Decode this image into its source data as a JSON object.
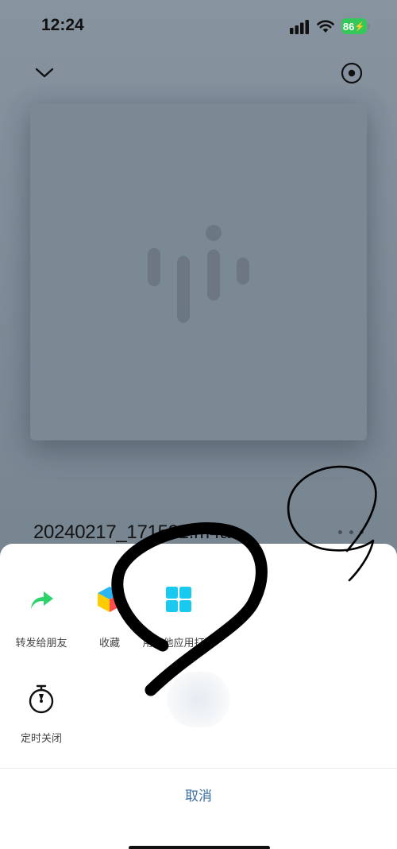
{
  "status_bar": {
    "time": "12:24",
    "battery_level": "86",
    "icons": [
      "signal-icon",
      "wifi-icon",
      "battery-charging-icon"
    ]
  },
  "header": {
    "collapse_icon": "chevron-down-icon",
    "record_icon": "target-circle-icon"
  },
  "player": {
    "file_name": "20240217_171521.m4a",
    "more_icon": "ellipsis-icon"
  },
  "share_sheet": {
    "actions": [
      {
        "label": "转发给朋友",
        "icon": "forward-arrow-icon"
      },
      {
        "label": "收藏",
        "icon": "favorite-cube-icon"
      },
      {
        "label": "用其他应用打开",
        "icon": "grid-apps-icon"
      },
      {
        "label": "定时关闭",
        "icon": "timer-icon"
      }
    ],
    "cancel_label": "取消"
  },
  "colors": {
    "background": "#7c8a96",
    "sheet": "#ffffff",
    "accent": "#3c6fa6",
    "forward_green": "#2bd36a",
    "apps_cyan": "#1ac9f0",
    "battery_green": "#34c759"
  }
}
